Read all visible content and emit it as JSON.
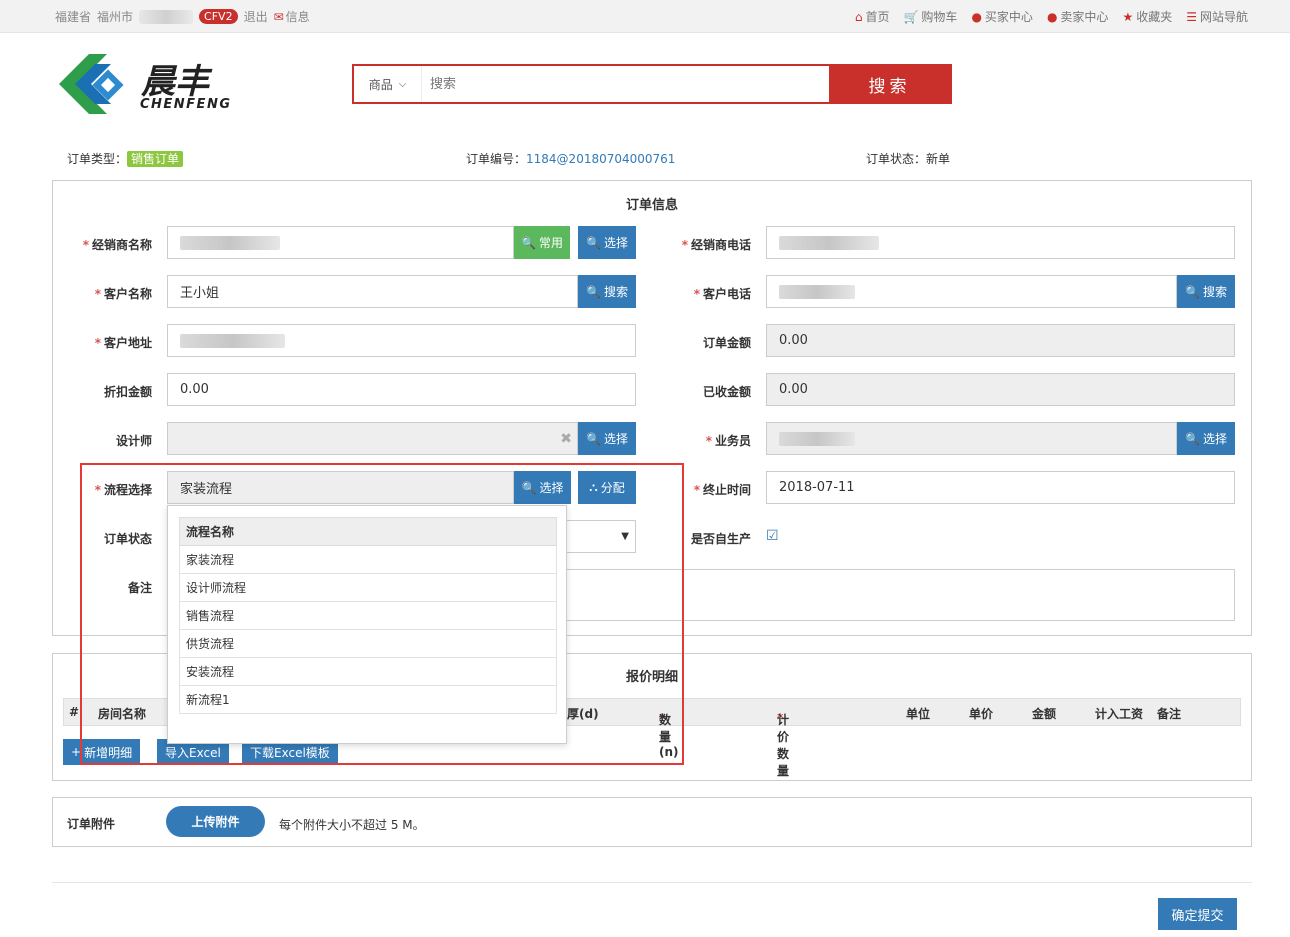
{
  "topbar": {
    "province": "福建省",
    "city": "福州市",
    "badge": "CFV2",
    "logout": "退出",
    "message": "信息",
    "nav": [
      {
        "icon": "home-icon",
        "glyph": "⌂",
        "label": "首页"
      },
      {
        "icon": "cart-icon",
        "glyph": "🛒",
        "label": "购物车"
      },
      {
        "icon": "user-icon",
        "glyph": "●",
        "label": "买家中心"
      },
      {
        "icon": "user-icon",
        "glyph": "●",
        "label": "卖家中心"
      },
      {
        "icon": "star-icon",
        "glyph": "★",
        "label": "收藏夹"
      },
      {
        "icon": "list-icon",
        "glyph": "☰",
        "label": "网站导航"
      }
    ]
  },
  "logo": {
    "cn": "晨丰",
    "en": "CHENFENG"
  },
  "search": {
    "category": "商品",
    "placeholder": "搜索",
    "button": "搜索"
  },
  "order_meta": {
    "type_label": "订单类型：",
    "type_value": "销售订单",
    "no_label": "订单编号：",
    "no_value": "1184@20180704000761",
    "status_label": "订单状态：",
    "status_value": "新单"
  },
  "order_info": {
    "title": "订单信息",
    "dealer_name_label": "经销商名称",
    "dealer_phone_label": "经销商电话",
    "customer_name_label": "客户名称",
    "customer_name_value": "王小姐",
    "customer_phone_label": "客户电话",
    "customer_address_label": "客户地址",
    "order_amount_label": "订单金额",
    "order_amount_value": "0.00",
    "discount_label": "折扣金额",
    "discount_value": "0.00",
    "received_label": "已收金额",
    "received_value": "0.00",
    "designer_label": "设计师",
    "salesman_label": "业务员",
    "flow_label": "流程选择",
    "flow_value": "家装流程",
    "deadline_label": "终止时间",
    "deadline_value": "2018-07-11",
    "order_status_label": "订单状态",
    "self_produce_label": "是否自生产",
    "remark_label": "备注",
    "btn_common": "常用",
    "btn_select": "选择",
    "btn_search": "搜索",
    "btn_assign": "分配"
  },
  "flow_dropdown": {
    "header": "流程名称",
    "items": [
      "家装流程",
      "设计师流程",
      "销售流程",
      "供货流程",
      "安装流程",
      "新流程1"
    ]
  },
  "quote": {
    "title": "报价明细",
    "columns": [
      "#",
      "房间名称",
      "厚(d)",
      "数量(n)",
      "计价数量",
      "单位",
      "单价",
      "金额",
      "计入工资",
      "备注"
    ],
    "btn_add": "新增明细",
    "btn_import": "导入Excel",
    "btn_template": "下载Excel模板"
  },
  "attachment": {
    "label": "订单附件",
    "upload": "上传附件",
    "note": "每个附件大小不超过 5 M。"
  },
  "submit": "确定提交"
}
